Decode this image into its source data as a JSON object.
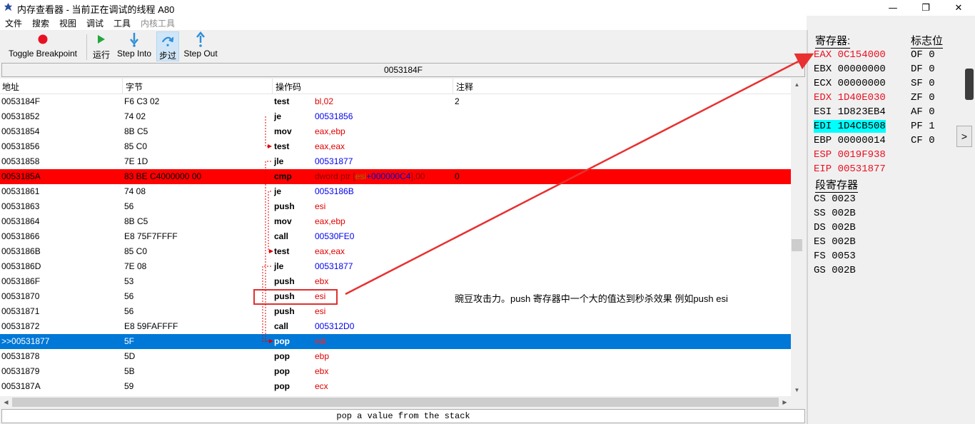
{
  "window": {
    "title": "内存查看器 - 当前正在调试的线程 A80",
    "minimize_glyph": "—",
    "restore_glyph": "❐",
    "close_glyph": "✕"
  },
  "menu": [
    "文件",
    "搜索",
    "视图",
    "调试",
    "工具",
    "内核工具"
  ],
  "toolbar": {
    "toggle_breakpoint": "Toggle Breakpoint",
    "run": "运行",
    "step_into": "Step Into",
    "step_over": "步过",
    "step_out": "Step Out",
    "icons": {
      "toggle_breakpoint": "red-dot-icon",
      "run": "green-play-icon",
      "step_into": "step-into-arrow-icon",
      "step_over": "step-over-arrow-icon",
      "step_out": "step-out-arrow-icon"
    },
    "colors": {
      "breakpoint": "#e81123",
      "run": "#22a83a",
      "step": "#2f8fd8"
    }
  },
  "address_bar": "0053184F",
  "columns": [
    "地址",
    "字节",
    "操作码",
    "注释"
  ],
  "rows": [
    {
      "addr": "0053184F",
      "bytes": "F6 C3 02",
      "op": "test",
      "arg": "bl,02",
      "comment": "2",
      "highlight": ""
    },
    {
      "addr": "00531852",
      "bytes": "74 02",
      "op": "je",
      "arg": "00531856",
      "comment": "",
      "highlight": ""
    },
    {
      "addr": "00531854",
      "bytes": "8B C5",
      "op": "mov",
      "arg": "eax,ebp",
      "comment": "",
      "highlight": ""
    },
    {
      "addr": "00531856",
      "bytes": "85 C0",
      "op": "test",
      "arg": "eax,eax",
      "comment": "",
      "highlight": ""
    },
    {
      "addr": "00531858",
      "bytes": "7E 1D",
      "op": "jle",
      "arg": "00531877",
      "comment": "",
      "highlight": ""
    },
    {
      "addr": "0053185A",
      "bytes": "83 BE C4000000 00",
      "op": "cmp",
      "arg": "dword ptr [esi+000000C4],00",
      "comment": "0",
      "highlight": "red"
    },
    {
      "addr": "00531861",
      "bytes": "74 08",
      "op": "je",
      "arg": "0053186B",
      "comment": "",
      "highlight": ""
    },
    {
      "addr": "00531863",
      "bytes": "56",
      "op": "push",
      "arg": "esi",
      "comment": "",
      "highlight": ""
    },
    {
      "addr": "00531864",
      "bytes": "8B C5",
      "op": "mov",
      "arg": "eax,ebp",
      "comment": "",
      "highlight": ""
    },
    {
      "addr": "00531866",
      "bytes": "E8 75F7FFFF",
      "op": "call",
      "arg": "00530FE0",
      "comment": "",
      "highlight": ""
    },
    {
      "addr": "0053186B",
      "bytes": "85 C0",
      "op": "test",
      "arg": "eax,eax",
      "comment": "",
      "highlight": ""
    },
    {
      "addr": "0053186D",
      "bytes": "7E 08",
      "op": "jle",
      "arg": "00531877",
      "comment": "",
      "highlight": ""
    },
    {
      "addr": "0053186F",
      "bytes": "53",
      "op": "push",
      "arg": "ebx",
      "comment": "",
      "highlight": ""
    },
    {
      "addr": "00531870",
      "bytes": "56",
      "op": "push",
      "arg": "esi",
      "comment": "",
      "highlight": ""
    },
    {
      "addr": "00531871",
      "bytes": "56",
      "op": "push",
      "arg": "esi",
      "comment": "",
      "highlight": ""
    },
    {
      "addr": "00531872",
      "bytes": "E8 59FAFFFF",
      "op": "call",
      "arg": "005312D0",
      "comment": "",
      "highlight": ""
    },
    {
      "addr": ">>00531877",
      "bytes": "5F",
      "op": "pop",
      "arg": "edi",
      "comment": "",
      "highlight": "blue"
    },
    {
      "addr": "00531878",
      "bytes": "5D",
      "op": "pop",
      "arg": "ebp",
      "comment": "",
      "highlight": ""
    },
    {
      "addr": "00531879",
      "bytes": "5B",
      "op": "pop",
      "arg": "ebx",
      "comment": "",
      "highlight": ""
    },
    {
      "addr": "0053187A",
      "bytes": "59",
      "op": "pop",
      "arg": "ecx",
      "comment": "",
      "highlight": ""
    }
  ],
  "cmp_arg_parts": {
    "prefix": "dword ptr [",
    "reg": "esi",
    "plus_off": "+000000C4",
    "suffix": "],00"
  },
  "annotation": "豌豆攻击力。push 寄存器中一个大的值达到秒杀效果 例如push esi",
  "status": "pop a value from the stack",
  "registers": {
    "title": "寄存器:",
    "flags_title": "标志位",
    "segments_title": "段寄存器",
    "general": [
      {
        "text": "EAX 0C154000",
        "style": "red"
      },
      {
        "text": "EBX 00000000",
        "style": ""
      },
      {
        "text": "ECX 00000000",
        "style": ""
      },
      {
        "text": "EDX 1D40E030",
        "style": "red"
      },
      {
        "text": "ESI 1D823EB4",
        "style": ""
      },
      {
        "text": "EDI 1D4CB508",
        "style": "cyan"
      },
      {
        "text": "EBP 00000014",
        "style": ""
      },
      {
        "text": "ESP 0019F938",
        "style": "red"
      },
      {
        "text": "EIP 00531877",
        "style": "red"
      }
    ],
    "flags": [
      "OF 0",
      "DF 0",
      "SF 0",
      "ZF 0",
      "AF 0",
      "PF 1",
      "CF 0"
    ],
    "segments": [
      "CS 0023",
      "SS 002B",
      "DS 002B",
      "ES 002B",
      "FS 0053",
      "GS 002B"
    ],
    "expand_glyph": ">"
  }
}
